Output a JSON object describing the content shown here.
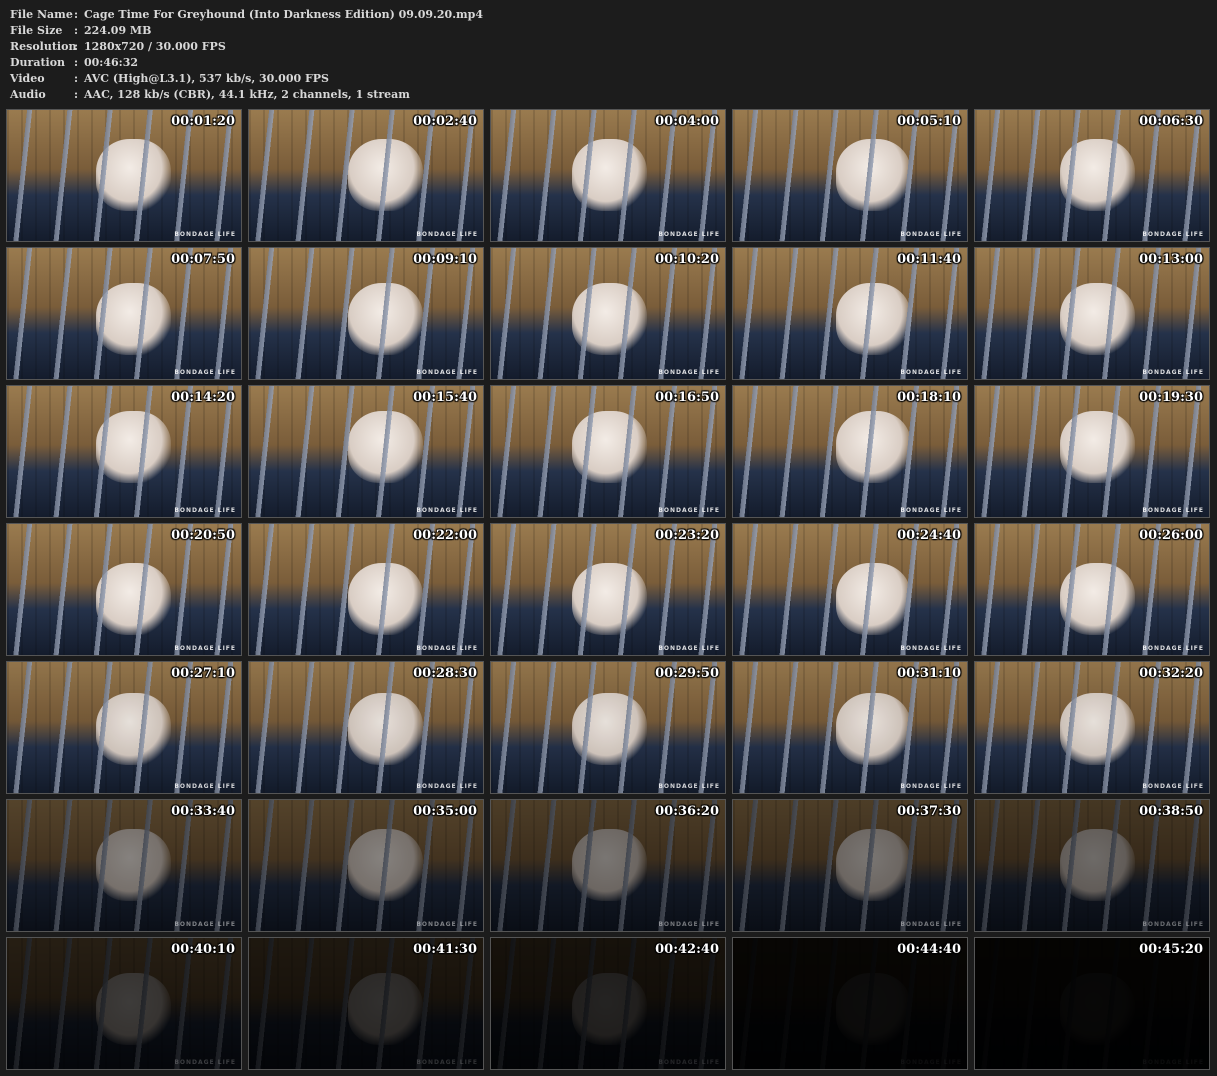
{
  "info": [
    {
      "key": "File Name",
      "value": "Cage Time For Greyhound (Into Darkness Edition) 09.09.20.mp4"
    },
    {
      "key": "File Size",
      "value": "224.09 MB"
    },
    {
      "key": "Resolution",
      "value": "1280x720 / 30.000 FPS"
    },
    {
      "key": "Duration",
      "value": "00:46:32"
    },
    {
      "key": "Video",
      "value": "AVC (High@L3.1), 537 kb/s, 30.000 FPS"
    },
    {
      "key": "Audio",
      "value": "AAC, 128 kb/s (CBR), 44.1 kHz, 2 channels, 1 stream"
    }
  ],
  "separator": ":",
  "watermark": "BONDAGE LIFE",
  "thumbnails": [
    {
      "time": "00:01:20",
      "brightness": 1.0
    },
    {
      "time": "00:02:40",
      "brightness": 1.0
    },
    {
      "time": "00:04:00",
      "brightness": 1.0
    },
    {
      "time": "00:05:10",
      "brightness": 1.0
    },
    {
      "time": "00:06:30",
      "brightness": 1.0
    },
    {
      "time": "00:07:50",
      "brightness": 1.0
    },
    {
      "time": "00:09:10",
      "brightness": 1.0
    },
    {
      "time": "00:10:20",
      "brightness": 1.0
    },
    {
      "time": "00:11:40",
      "brightness": 1.0
    },
    {
      "time": "00:13:00",
      "brightness": 1.0
    },
    {
      "time": "00:14:20",
      "brightness": 1.0
    },
    {
      "time": "00:15:40",
      "brightness": 1.0
    },
    {
      "time": "00:16:50",
      "brightness": 1.0
    },
    {
      "time": "00:18:10",
      "brightness": 1.0
    },
    {
      "time": "00:19:30",
      "brightness": 1.0
    },
    {
      "time": "00:20:50",
      "brightness": 1.0
    },
    {
      "time": "00:22:00",
      "brightness": 1.0
    },
    {
      "time": "00:23:20",
      "brightness": 1.0
    },
    {
      "time": "00:24:40",
      "brightness": 1.0
    },
    {
      "time": "00:26:00",
      "brightness": 1.0
    },
    {
      "time": "00:27:10",
      "brightness": 0.95
    },
    {
      "time": "00:28:30",
      "brightness": 0.95
    },
    {
      "time": "00:29:50",
      "brightness": 0.95
    },
    {
      "time": "00:31:10",
      "brightness": 0.95
    },
    {
      "time": "00:32:20",
      "brightness": 0.95
    },
    {
      "time": "00:33:40",
      "brightness": 0.55
    },
    {
      "time": "00:35:00",
      "brightness": 0.55
    },
    {
      "time": "00:36:20",
      "brightness": 0.5
    },
    {
      "time": "00:37:30",
      "brightness": 0.5
    },
    {
      "time": "00:38:50",
      "brightness": 0.45
    },
    {
      "time": "00:40:10",
      "brightness": 0.25
    },
    {
      "time": "00:41:30",
      "brightness": 0.2
    },
    {
      "time": "00:42:40",
      "brightness": 0.15
    },
    {
      "time": "00:44:40",
      "brightness": 0.05
    },
    {
      "time": "00:45:20",
      "brightness": 0.03
    }
  ]
}
